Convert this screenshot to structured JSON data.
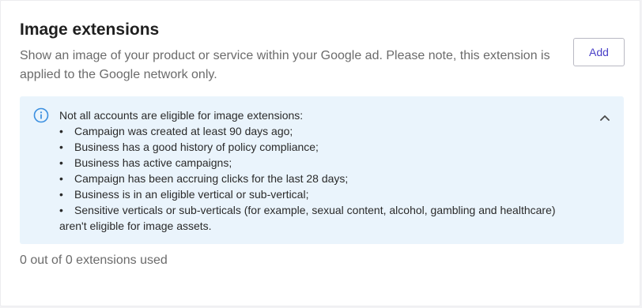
{
  "card": {
    "title": "Image extensions",
    "description": "Show an image of your product or service within your Google ad. Please note, this extension is applied to the Google network only.",
    "add_label": "Add"
  },
  "notice": {
    "icon": "info-icon",
    "toggle_icon": "chevron-up-icon",
    "heading": "Not all accounts are eligible for image extensions:",
    "bullet": "•",
    "items": [
      "Campaign was created at least 90 days ago;",
      "Business has a good history of policy compliance;",
      "Business has active campaigns;",
      "Campaign has been accruing clicks for the last 28 days;",
      "Business is in an eligible vertical or sub-vertical;",
      "Sensitive verticals or sub-verticals (for example, sexual content, alcohol, gambling and healthcare) aren't eligible for image assets."
    ]
  },
  "usage": {
    "text": "0 out of 0 extensions used"
  },
  "colors": {
    "accent": "#4a41c8",
    "notice_background": "#eaf4fc",
    "info_icon": "#3b8fe0"
  }
}
